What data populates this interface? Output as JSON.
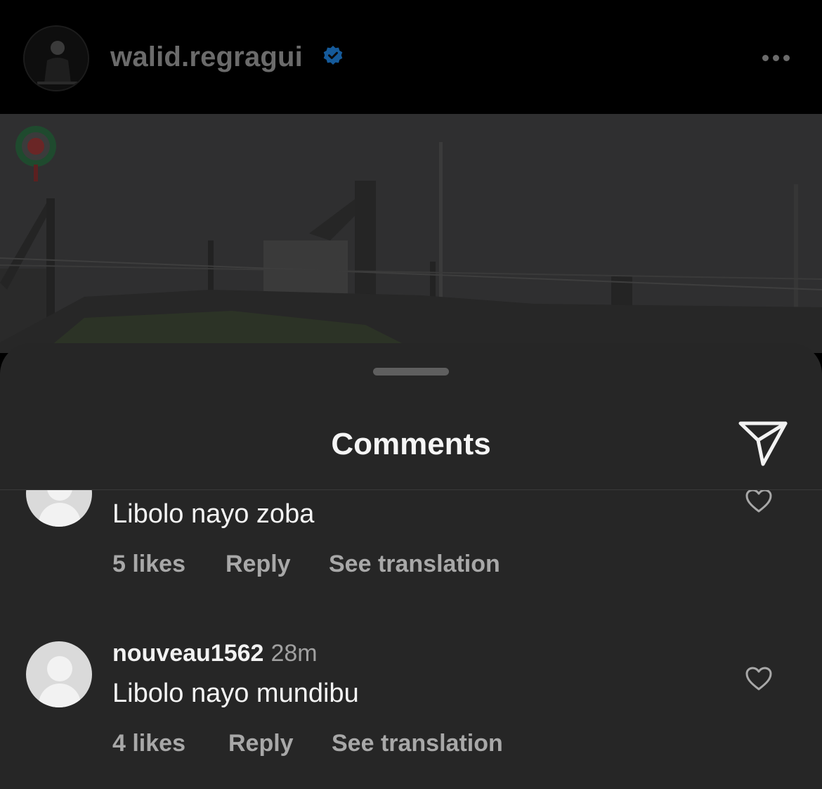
{
  "header": {
    "username": "walid.regragui",
    "verified": true,
    "more_icon": "more-horizontal-icon"
  },
  "sheet": {
    "title": "Comments",
    "share_icon": "send-icon"
  },
  "comments": [
    {
      "username": "",
      "time": "",
      "text": "Libolo nayo zoba",
      "likes": "5 likes",
      "reply": "Reply",
      "translate": "See translation"
    },
    {
      "username": "nouveau1562",
      "time": "28m",
      "text": "Libolo nayo mundibu",
      "likes": "4 likes",
      "reply": "Reply",
      "translate": "See translation"
    }
  ],
  "colors": {
    "sheet_background": "#262626",
    "verified_blue": "#1877d4",
    "secondary_text": "#a8a8a8"
  }
}
